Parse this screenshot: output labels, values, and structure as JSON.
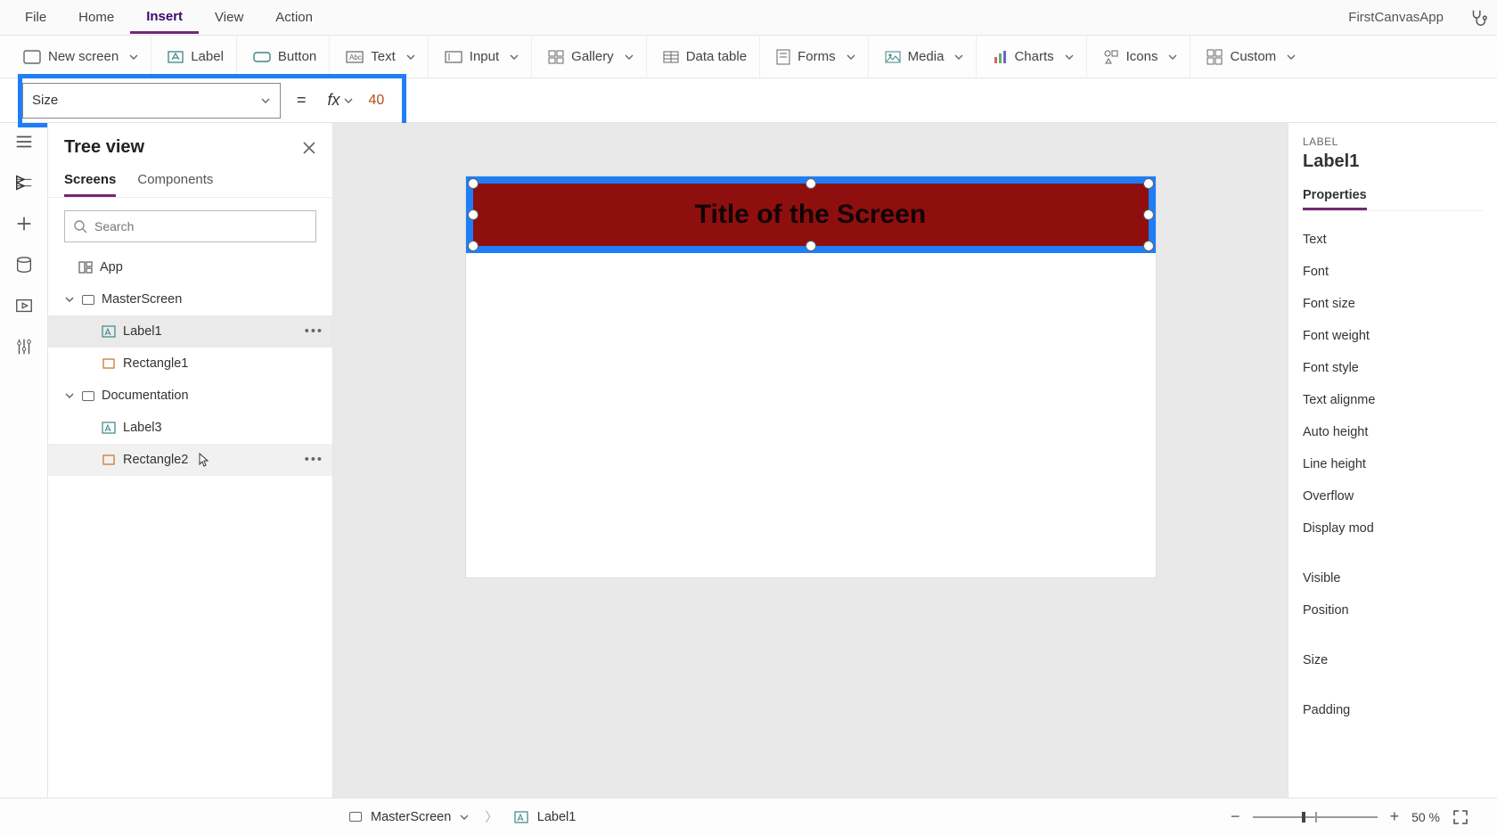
{
  "menu": {
    "items": [
      "File",
      "Home",
      "Insert",
      "View",
      "Action"
    ],
    "active_index": 2,
    "app_name": "FirstCanvasApp"
  },
  "ribbon": {
    "new_screen": "New screen",
    "label": "Label",
    "button": "Button",
    "text": "Text",
    "input": "Input",
    "gallery": "Gallery",
    "data_table": "Data table",
    "forms": "Forms",
    "media": "Media",
    "charts": "Charts",
    "icons": "Icons",
    "custom": "Custom"
  },
  "formula": {
    "property": "Size",
    "value": "40"
  },
  "tree": {
    "title": "Tree view",
    "tabs": [
      "Screens",
      "Components"
    ],
    "active_tab": 0,
    "search_placeholder": "Search",
    "app_label": "App",
    "nodes": [
      {
        "name": "MasterScreen",
        "children": [
          {
            "name": "Label1",
            "selected": true
          },
          {
            "name": "Rectangle1"
          }
        ]
      },
      {
        "name": "Documentation",
        "children": [
          {
            "name": "Label3"
          },
          {
            "name": "Rectangle2",
            "hover": true
          }
        ]
      }
    ]
  },
  "canvas": {
    "title_text": "Title of the Screen"
  },
  "props_panel": {
    "type_label": "LABEL",
    "element_name": "Label1",
    "active_tab": "Properties",
    "rows": [
      "Text",
      "Font",
      "Font size",
      "Font weight",
      "Font style",
      "Text alignme",
      "Auto height",
      "Line height",
      "Overflow",
      "Display mod",
      "",
      "Visible",
      "Position",
      "",
      "Size",
      "",
      "Padding"
    ]
  },
  "breadcrumb": {
    "screen": "MasterScreen",
    "element": "Label1"
  },
  "zoom": {
    "percent": "50",
    "unit": "%"
  }
}
